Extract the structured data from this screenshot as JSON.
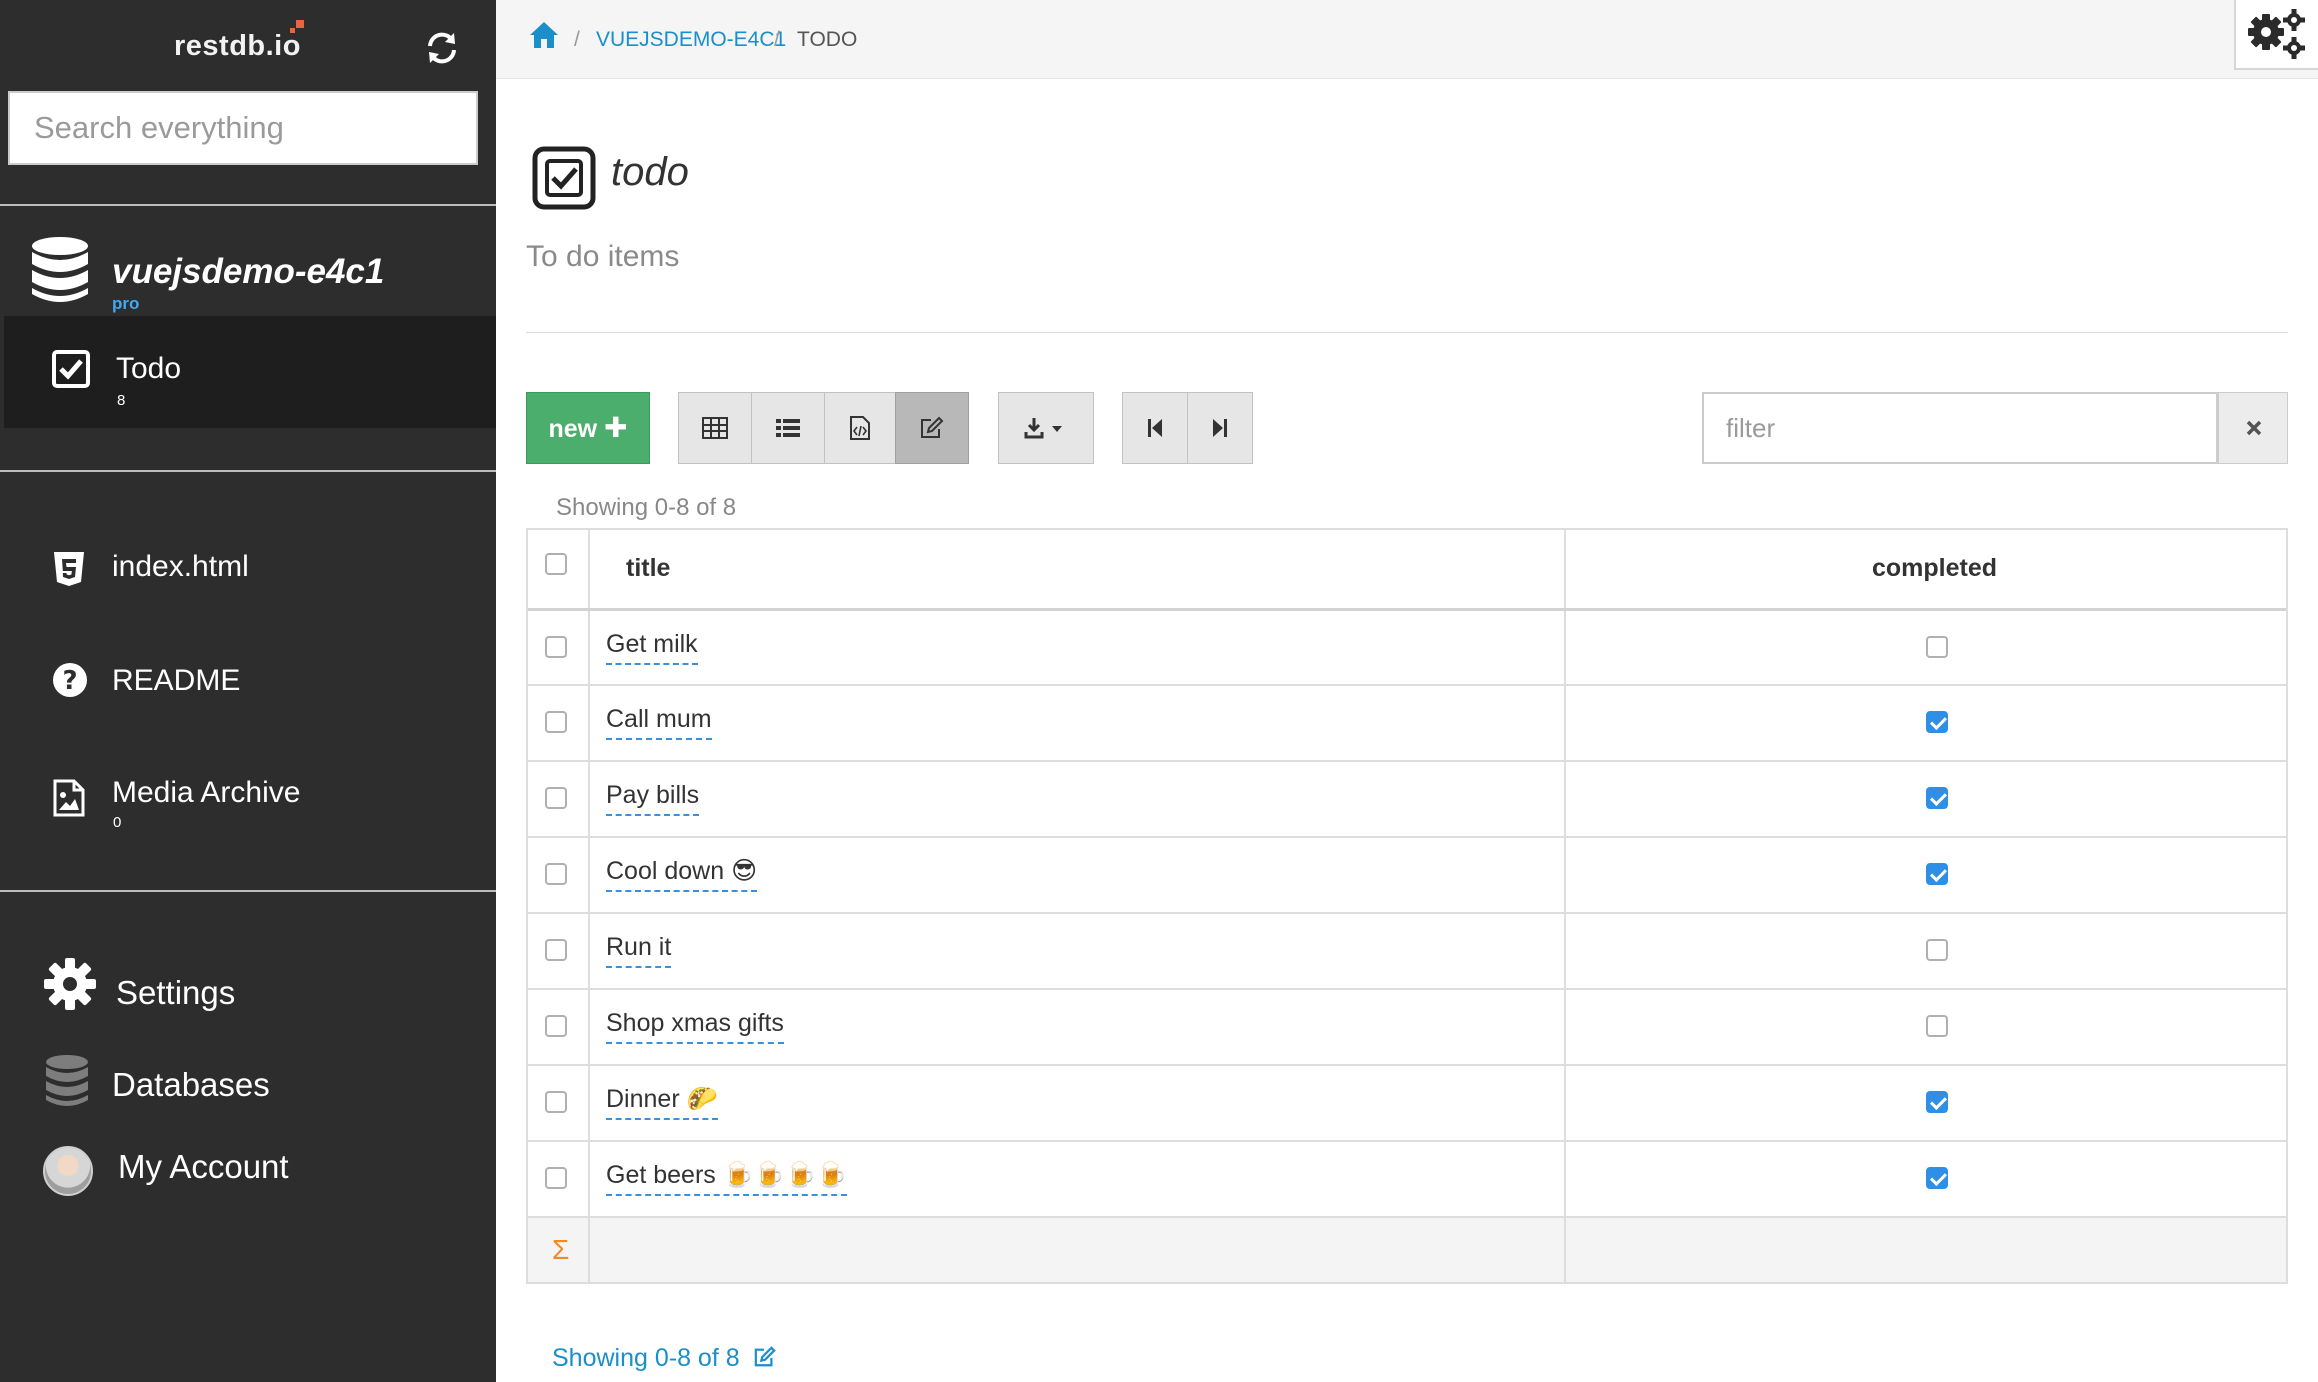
{
  "sidebar": {
    "brand": "restdb.io",
    "search_placeholder": "Search everything",
    "database": {
      "name": "vuejsdemo-e4c1",
      "tier": "pro"
    },
    "collections": [
      {
        "label": "Todo",
        "count": "8"
      }
    ],
    "pages": [
      {
        "label": "index.html"
      },
      {
        "label": "README"
      },
      {
        "label": "Media Archive",
        "count": "0"
      }
    ],
    "bottom": [
      {
        "label": "Settings"
      },
      {
        "label": "Databases"
      },
      {
        "label": "My Account"
      }
    ]
  },
  "breadcrumb": {
    "items": [
      "VUEJSDEMO-E4C1",
      "TODO"
    ],
    "separator": "/"
  },
  "page": {
    "title": "todo",
    "description": "To do items"
  },
  "toolbar": {
    "new_label": "new",
    "filter_placeholder": "filter",
    "active_view": "form-edit"
  },
  "table": {
    "showing": "Showing 0-8 of 8",
    "columns": [
      "title",
      "completed"
    ],
    "rows": [
      {
        "title": "Get milk",
        "completed": false
      },
      {
        "title": "Call mum",
        "completed": true
      },
      {
        "title": "Pay bills",
        "completed": true
      },
      {
        "title": "Cool down 😎",
        "completed": true
      },
      {
        "title": "Run it",
        "completed": false
      },
      {
        "title": "Shop xmas gifts",
        "completed": false
      },
      {
        "title": "Dinner 🌮",
        "completed": true
      },
      {
        "title": "Get beers 🍺🍺🍺🍺",
        "completed": true
      }
    ],
    "sum_symbol": "Σ"
  },
  "footer": {
    "showing": "Showing 0-8 of 8"
  },
  "colors": {
    "sidebar_bg": "#2d2d2d",
    "accent_blue": "#1a8fc9",
    "checkbox_blue": "#2f8fe6",
    "new_button": "#4cae6c",
    "brand_orange": "#e8663d",
    "sigma_orange": "#f08a24"
  }
}
